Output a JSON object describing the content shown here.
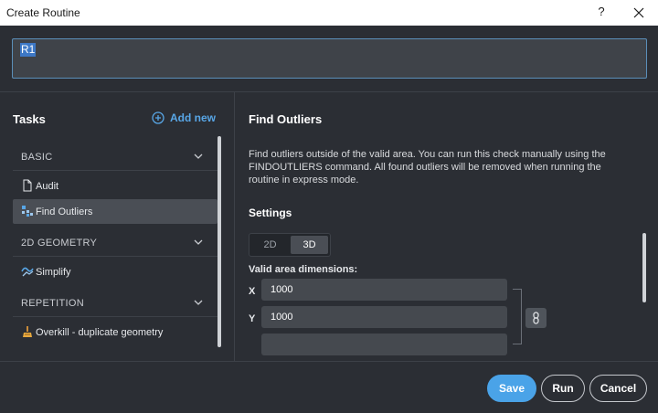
{
  "window": {
    "title": "Create Routine",
    "help_label": "?"
  },
  "routine_name": {
    "value": "R1"
  },
  "tasks_panel": {
    "title": "Tasks",
    "add_new_label": "Add new",
    "groups": [
      {
        "label": "BASIC",
        "items": [
          {
            "label": "Audit",
            "icon": "document-icon"
          },
          {
            "label": "Find Outliers",
            "icon": "outliers-icon",
            "selected": true
          }
        ]
      },
      {
        "label": "2D GEOMETRY",
        "items": [
          {
            "label": "Simplify",
            "icon": "simplify-icon"
          }
        ]
      },
      {
        "label": "REPETITION",
        "items": [
          {
            "label": "Overkill - duplicate geometry",
            "icon": "overkill-icon"
          }
        ]
      }
    ]
  },
  "detail": {
    "title": "Find Outliers",
    "description": "Find outliers outside of the valid area. You can run this check manually using the FINDOUTLIERS command. All found outliers will be removed when running the routine in express mode.",
    "settings_title": "Settings",
    "mode_options": [
      "2D",
      "3D"
    ],
    "mode_selected": "3D",
    "valid_area_label": "Valid area dimensions:",
    "dimensions": [
      {
        "axis": "X",
        "value": "1000"
      },
      {
        "axis": "Y",
        "value": "1000"
      }
    ]
  },
  "footer": {
    "save_label": "Save",
    "run_label": "Run",
    "cancel_label": "Cancel"
  },
  "colors": {
    "accent": "#4aa3e8",
    "background": "#2b2e34",
    "selected_item": "#4a4e55"
  }
}
